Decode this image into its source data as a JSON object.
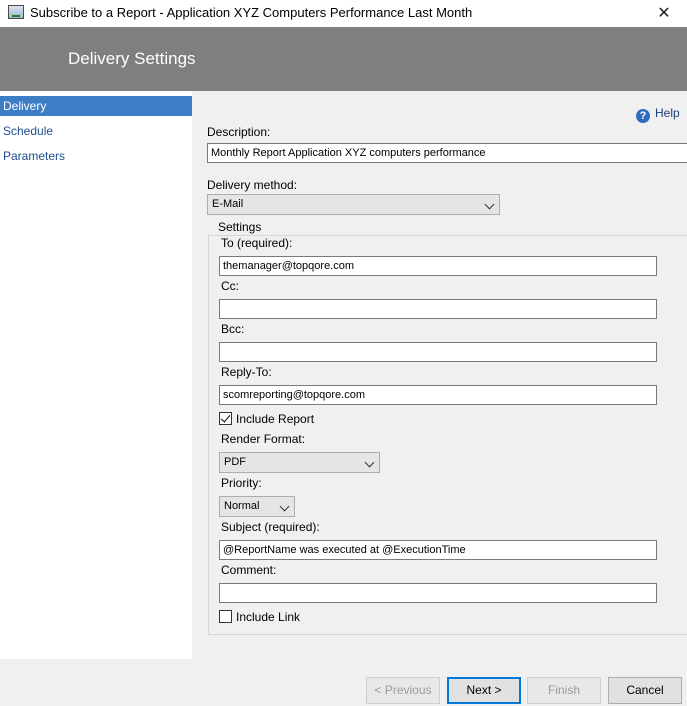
{
  "window": {
    "title": "Subscribe to a Report - Application XYZ Computers Performance Last Month",
    "close_glyph": "✕"
  },
  "header": {
    "title": "Delivery Settings"
  },
  "sidebar": {
    "items": [
      {
        "label": "Delivery",
        "active": true
      },
      {
        "label": "Schedule",
        "active": false
      },
      {
        "label": "Parameters",
        "active": false
      }
    ]
  },
  "help": {
    "icon_glyph": "?",
    "label": "Help"
  },
  "description": {
    "label": "Description:",
    "value": "Monthly Report Application XYZ computers performance"
  },
  "delivery_method": {
    "label": "Delivery method:",
    "value": "E-Mail"
  },
  "settings": {
    "legend": "Settings",
    "to": {
      "label": "To (required):",
      "value": "themanager@topqore.com"
    },
    "cc": {
      "label": "Cc:",
      "value": ""
    },
    "bcc": {
      "label": "Bcc:",
      "value": ""
    },
    "reply_to": {
      "label": "Reply-To:",
      "value": "scomreporting@topqore.com"
    },
    "include_report": {
      "label": "Include Report",
      "checked": true
    },
    "render_format": {
      "label": "Render Format:",
      "value": "PDF"
    },
    "priority": {
      "label": "Priority:",
      "value": "Normal"
    },
    "subject": {
      "label": "Subject (required):",
      "value": "@ReportName was executed at @ExecutionTime"
    },
    "comment": {
      "label": "Comment:",
      "value": ""
    },
    "include_link": {
      "label": "Include Link",
      "checked": false
    }
  },
  "footer": {
    "previous_label": "< Previous",
    "next_label": "Next >",
    "finish_label": "Finish",
    "cancel_label": "Cancel"
  }
}
